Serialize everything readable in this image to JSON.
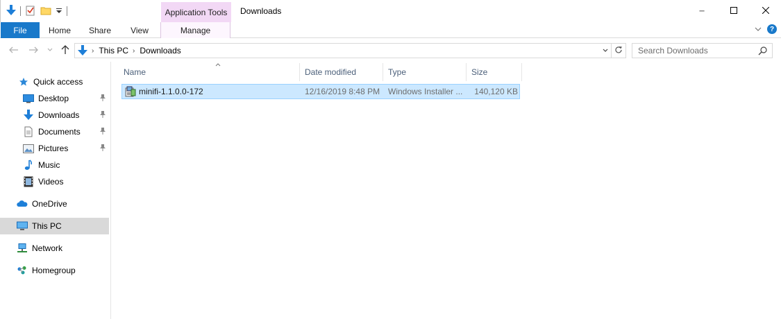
{
  "window": {
    "title": "Downloads",
    "context_tab": "Application Tools",
    "controls": {
      "minimize": "─",
      "maximize": "☐",
      "close": "✕"
    }
  },
  "quick_access_toolbar": {
    "icons": [
      "download-arrow-icon",
      "properties-check-icon",
      "new-folder-icon",
      "customize-dropdown-icon"
    ]
  },
  "ribbon": {
    "file": "File",
    "tabs": [
      "Home",
      "Share",
      "View"
    ],
    "manage": "Manage",
    "expand": "⌄",
    "help": "?"
  },
  "address": {
    "path": [
      "This PC",
      "Downloads"
    ],
    "search_placeholder": "Search Downloads"
  },
  "nav_pane": {
    "quick_access": "Quick access",
    "pinned": [
      {
        "label": "Desktop",
        "icon": "desktop-icon"
      },
      {
        "label": "Downloads",
        "icon": "downloads-icon"
      },
      {
        "label": "Documents",
        "icon": "documents-icon"
      },
      {
        "label": "Pictures",
        "icon": "pictures-icon"
      }
    ],
    "items": [
      {
        "label": "Music",
        "icon": "music-icon"
      },
      {
        "label": "Videos",
        "icon": "videos-icon"
      }
    ],
    "onedrive": "OneDrive",
    "this_pc": "This PC",
    "network": "Network",
    "homegroup": "Homegroup"
  },
  "file_list": {
    "columns": [
      "Name",
      "Date modified",
      "Type",
      "Size"
    ],
    "sort_column": "Name",
    "rows": [
      {
        "name": "minifi-1.1.0.0-172",
        "date_modified": "12/16/2019 8:48 PM",
        "type": "Windows Installer ...",
        "size": "140,120 KB",
        "selected": true
      }
    ]
  },
  "colors": {
    "accent": "#1979ca",
    "context_tab": "#f2d8f5",
    "selection_fill": "#cce8ff",
    "selection_border": "#99d1ff",
    "nav_selected": "#d9d9d9",
    "column_header_text": "#4c607a"
  }
}
